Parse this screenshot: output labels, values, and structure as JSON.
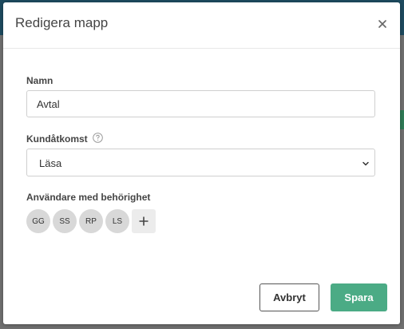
{
  "modal": {
    "title": "Redigera mapp",
    "close_icon": "close-icon"
  },
  "fields": {
    "name_label": "Namn",
    "name_value": "Avtal",
    "access_label": "Kundåtkomst",
    "access_help_icon": "question-circle-icon",
    "access_value": "Läsa",
    "access_chevron_icon": "chevron-down-icon",
    "users_label": "Användare med behörighet"
  },
  "users": [
    {
      "initials": "GG"
    },
    {
      "initials": "SS"
    },
    {
      "initials": "RP"
    },
    {
      "initials": "LS"
    }
  ],
  "add_user_icon": "plus-icon",
  "buttons": {
    "cancel": "Avbryt",
    "save": "Spara"
  },
  "colors": {
    "primary": "#4bab85",
    "header_backdrop": "#1d4a5e",
    "avatar_bg": "#d8d8d8"
  }
}
